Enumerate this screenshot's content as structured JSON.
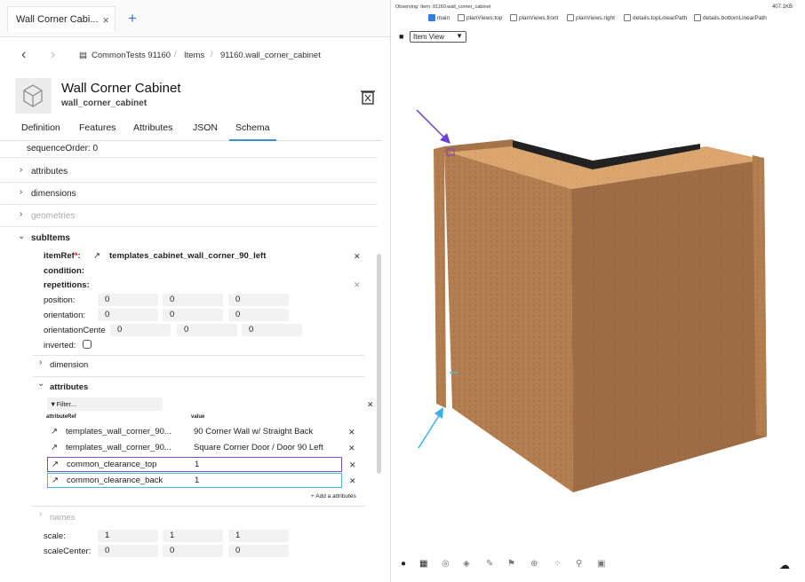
{
  "tab": {
    "title": "Wall Corner Cabi...",
    "close": "×",
    "new": "+"
  },
  "breadcrumb": [
    "CommonTests 91160",
    "Items",
    "91160.wall_corner_cabinet"
  ],
  "header": {
    "title": "Wall Corner Cabinet",
    "subtitle": "wall_corner_cabinet"
  },
  "tabs": [
    "Definition",
    "Features",
    "Attributes",
    "JSON",
    "Schema"
  ],
  "tree": {
    "sequence": "sequenceOrder:  0",
    "attributes": "attributes",
    "dimensions": "dimensions",
    "geometries": "geometries",
    "subitems": "subItems"
  },
  "sub": {
    "itemref_label": "itemRef",
    "itemref_value": "templates_cabinet_wall_corner_90_left",
    "condition": "condition:",
    "repetitions": "repetitions:",
    "position": "position:",
    "orientation": "orientation:",
    "orientationCenter": "orientationCente",
    "inverted": "inverted:",
    "dimension": "dimension",
    "attributes": "attributes",
    "filter": "Filter...",
    "col_ref": "attributeRef",
    "col_val": "value",
    "add": "+ Add a attributes",
    "names": "names",
    "scale": "scale:",
    "scaleCenter": "scaleCenter:"
  },
  "vals": {
    "zero": "0",
    "one": "1"
  },
  "attr_rows": [
    {
      "ref": "templates_wall_corner_90...",
      "val": "90 Corner Wall w/ Straight Back"
    },
    {
      "ref": "templates_wall_corner_90...",
      "val": "Square Corner Door / Door 90 Left"
    },
    {
      "ref": "common_clearance_top",
      "val": "1"
    },
    {
      "ref": "common_clearance_back",
      "val": "1"
    }
  ],
  "viewer": {
    "observing": "Observing: Item: 91160.wall_corner_cabinet",
    "size": "407.1KB",
    "select": "Item View",
    "checks": [
      "main",
      "planViews.top",
      "planViews.front",
      "planViews.right",
      "details.topLinearPath",
      "details.bottomLinearPath"
    ]
  }
}
